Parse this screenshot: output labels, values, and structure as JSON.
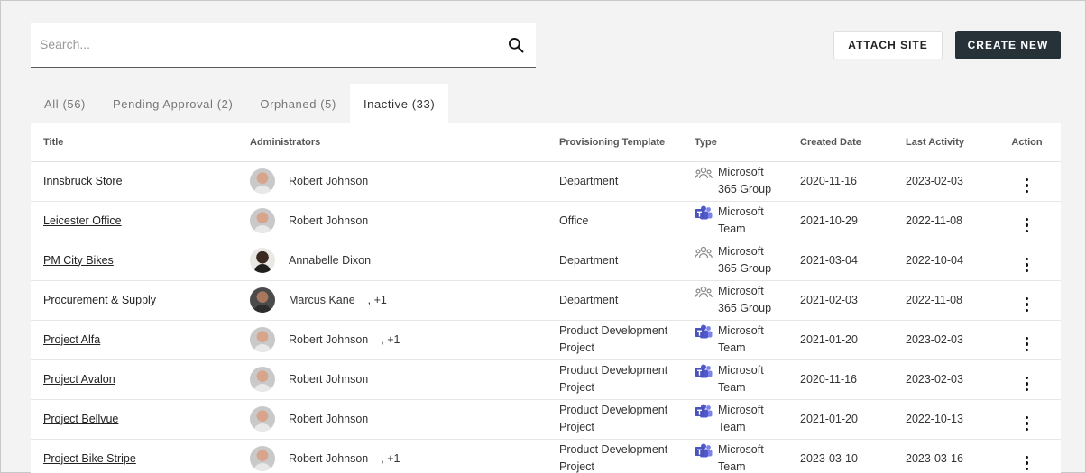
{
  "search": {
    "placeholder": "Search..."
  },
  "buttons": {
    "attach_label": "ATTACH SITE",
    "create_label": "CREATE NEW"
  },
  "tabs": [
    {
      "label": "All (56)"
    },
    {
      "label": "Pending Approval (2)"
    },
    {
      "label": "Orphaned (5)"
    },
    {
      "label": "Inactive (33)"
    }
  ],
  "table": {
    "headers": {
      "title": "Title",
      "administrators": "Administrators",
      "template": "Provisioning Template",
      "type": "Type",
      "created": "Created Date",
      "activity": "Last Activity",
      "action": "Action"
    },
    "rows": [
      {
        "title": "Innsbruck Store",
        "admin": "Robert Johnson",
        "extra": "",
        "template": "Department",
        "type": "Microsoft 365 Group",
        "created": "2020-11-16",
        "activity": "2023-02-03"
      },
      {
        "title": "Leicester Office",
        "admin": "Robert Johnson",
        "extra": "",
        "template": "Office",
        "type": "Microsoft Team",
        "created": "2021-10-29",
        "activity": "2022-11-08"
      },
      {
        "title": "PM City Bikes",
        "admin": "Annabelle Dixon",
        "extra": "",
        "template": "Department",
        "type": "Microsoft 365 Group",
        "created": "2021-03-04",
        "activity": "2022-10-04"
      },
      {
        "title": "Procurement & Supply",
        "admin": "Marcus Kane",
        "extra": ", +1",
        "template": "Department",
        "type": "Microsoft 365 Group",
        "created": "2021-02-03",
        "activity": "2022-11-08"
      },
      {
        "title": "Project Alfa",
        "admin": "Robert Johnson",
        "extra": ", +1",
        "template": "Product Development Project",
        "type": "Microsoft Team",
        "created": "2021-01-20",
        "activity": "2023-02-03"
      },
      {
        "title": "Project Avalon",
        "admin": "Robert Johnson",
        "extra": "",
        "template": "Product Development Project",
        "type": "Microsoft Team",
        "created": "2020-11-16",
        "activity": "2023-02-03"
      },
      {
        "title": "Project Bellvue",
        "admin": "Robert Johnson",
        "extra": "",
        "template": "Product Development Project",
        "type": "Microsoft Team",
        "created": "2021-01-20",
        "activity": "2022-10-13"
      },
      {
        "title": "Project Bike Stripe",
        "admin": "Robert Johnson",
        "extra": ", +1",
        "template": "Product Development Project",
        "type": "Microsoft Team",
        "created": "2023-03-10",
        "activity": "2023-03-16"
      }
    ]
  }
}
